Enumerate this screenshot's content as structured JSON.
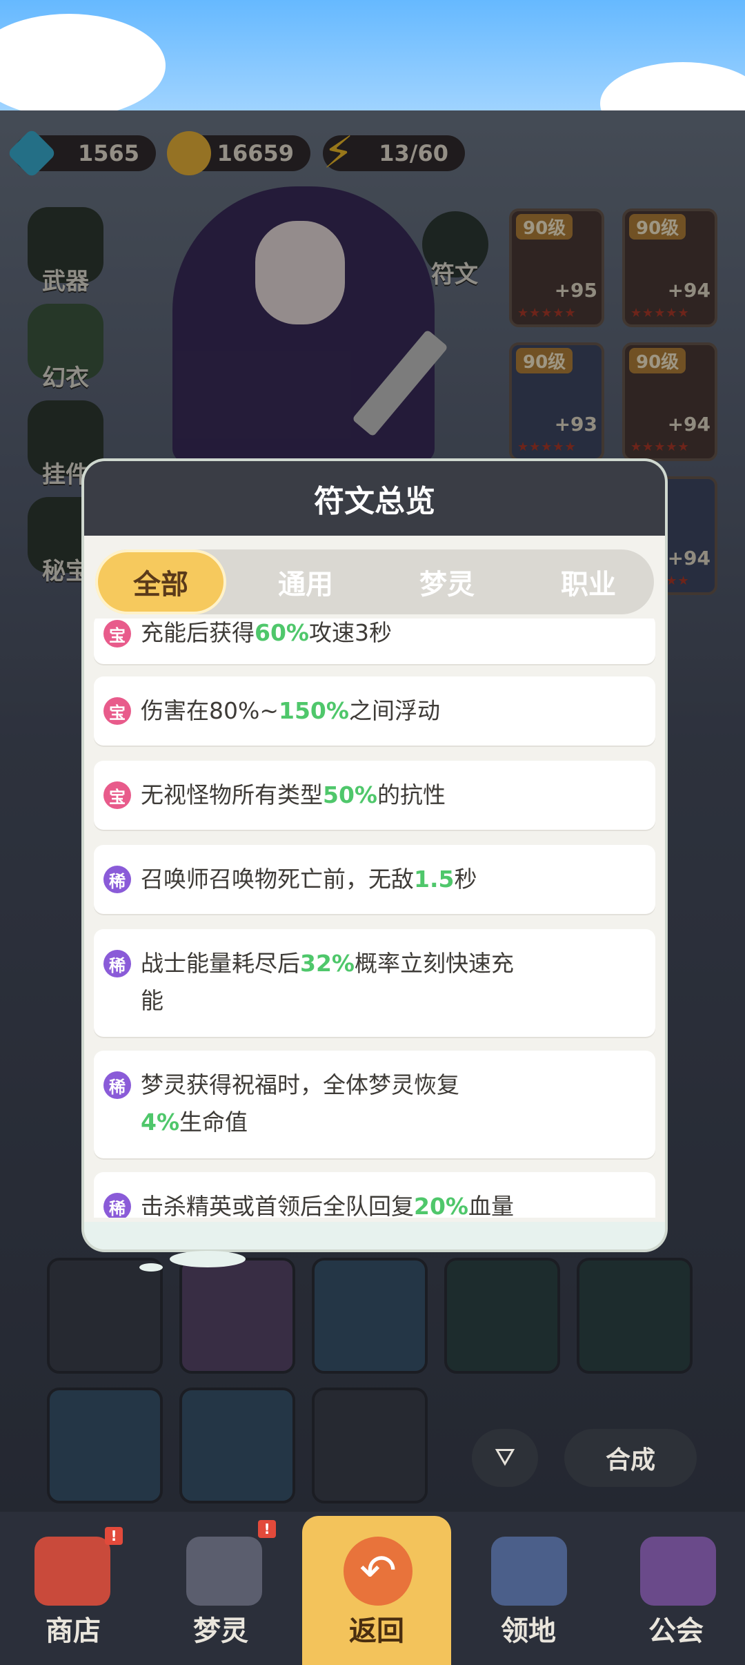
{
  "currency": {
    "gems": "1565",
    "gold": "16659",
    "energy": "13/60"
  },
  "side_nav": [
    {
      "label": "武器",
      "icon": "weapon-icon"
    },
    {
      "label": "幻衣",
      "icon": "outfit-icon"
    },
    {
      "label": "挂件",
      "icon": "pendant-icon"
    },
    {
      "label": "秘宝",
      "icon": "treasure-icon"
    }
  ],
  "rune_button": {
    "label": "符文"
  },
  "equipment": [
    {
      "level": "90级",
      "plus": "+95"
    },
    {
      "level": "90级",
      "plus": "+94"
    },
    {
      "level": "90级",
      "plus": "+93"
    },
    {
      "level": "90级",
      "plus": "+94"
    },
    {
      "level": "",
      "plus": "+94"
    }
  ],
  "modal": {
    "title": "符文总览",
    "tabs": [
      "全部",
      "通用",
      "梦灵",
      "职业"
    ],
    "active_tab": 0,
    "items": [
      {
        "badge": "宝",
        "pre": "充能后获得",
        "hl": "60%",
        "post": "攻速3秒",
        "line2_pre": "",
        "line2_hl": "",
        "line2_post": ""
      },
      {
        "badge": "宝",
        "pre": "伤害在80%~",
        "hl": "150%",
        "post": "之间浮动",
        "line2_pre": "",
        "line2_hl": "",
        "line2_post": ""
      },
      {
        "badge": "宝",
        "pre": "无视怪物所有类型",
        "hl": "50%",
        "post": "的抗性",
        "line2_pre": "",
        "line2_hl": "",
        "line2_post": ""
      },
      {
        "badge": "稀",
        "pre": "召唤师召唤物死亡前，无敌",
        "hl": "1.5",
        "post": "秒",
        "line2_pre": "",
        "line2_hl": "",
        "line2_post": ""
      },
      {
        "badge": "稀",
        "pre": "战士能量耗尽后",
        "hl": "32%",
        "post": "概率立刻快速充",
        "line2_pre": "能",
        "line2_hl": "",
        "line2_post": ""
      },
      {
        "badge": "稀",
        "pre": "梦灵获得祝福时，全体梦灵恢复",
        "hl": "",
        "post": "",
        "line2_pre": "",
        "line2_hl": "4%",
        "line2_post": "生命值"
      },
      {
        "badge": "稀",
        "pre": "击杀精英或首领后全队回复",
        "hl": "20%",
        "post": "血量",
        "line2_pre": "",
        "line2_hl": "",
        "line2_post": ""
      }
    ]
  },
  "controls": {
    "synthesize": "合成",
    "filter_icon": "filter-icon"
  },
  "bottom_nav": [
    {
      "label": "商店",
      "badge": "!"
    },
    {
      "label": "梦灵",
      "badge": "!"
    },
    {
      "label": "返回",
      "badge": ""
    },
    {
      "label": "领地",
      "badge": ""
    },
    {
      "label": "公会",
      "badge": ""
    }
  ],
  "colors": {
    "highlight_green": "#4fc76b",
    "tab_active": "#f6c95d",
    "badge_treasure": "#e85b8b",
    "badge_rare": "#8a5bd8"
  }
}
